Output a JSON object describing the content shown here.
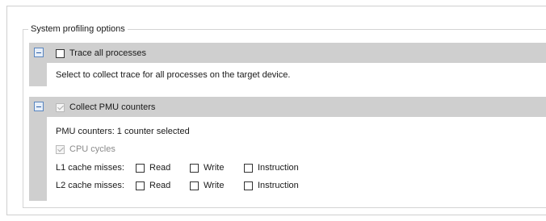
{
  "group": {
    "title": "System profiling options"
  },
  "trace_section": {
    "checkbox_label": "Trace all processes",
    "checked": false,
    "description": "Select to collect trace for all processes on the target device."
  },
  "pmu_section": {
    "checkbox_label": "Collect PMU counters",
    "checked": true,
    "summary": "PMU counters: 1 counter selected",
    "cpu_cycles_label": "CPU cycles",
    "rows": [
      {
        "label": "L1 cache misses:",
        "options": [
          "Read",
          "Write",
          "Instruction"
        ]
      },
      {
        "label": "L2 cache misses:",
        "options": [
          "Read",
          "Write",
          "Instruction"
        ]
      }
    ]
  },
  "colors": {
    "section_header": "#cfcfcf",
    "collapse_icon": "#2a5ea8"
  },
  "icons": {
    "collapse": "collapse-minus-icon",
    "check": "checkmark-icon"
  }
}
